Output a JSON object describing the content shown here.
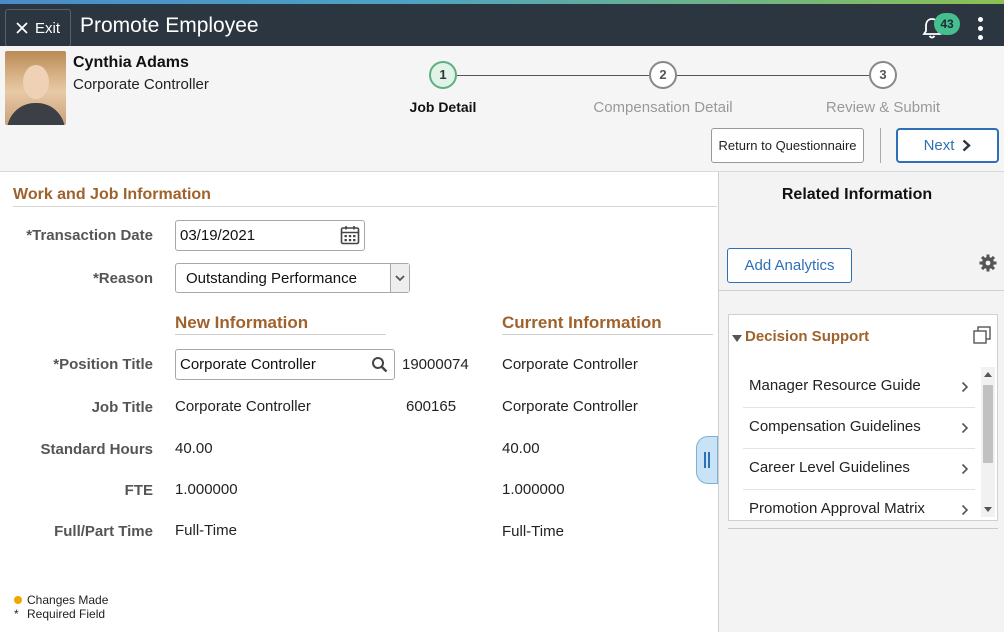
{
  "header": {
    "exit_label": "Exit",
    "app_title": "Promote Employee",
    "notification_count": "43"
  },
  "employee": {
    "name": "Cynthia Adams",
    "title": "Corporate Controller"
  },
  "steps": [
    {
      "number": "1",
      "label": "Job Detail",
      "active": true
    },
    {
      "number": "2",
      "label": "Compensation Detail",
      "active": false
    },
    {
      "number": "3",
      "label": "Review & Submit",
      "active": false
    }
  ],
  "actions": {
    "return_label": "Return to Questionnaire",
    "next_label": "Next"
  },
  "main": {
    "section_title": "Work and Job Information",
    "transaction_date_label": "*Transaction Date",
    "transaction_date_value": "03/19/2021",
    "reason_label": "*Reason",
    "reason_value": "Outstanding Performance",
    "new_info_header": "New Information",
    "current_info_header": "Current Information",
    "rows": {
      "position_title": {
        "label": "*Position Title",
        "new": "Corporate Controller",
        "code": "19000074",
        "current": "Corporate Controller"
      },
      "job_title": {
        "label": "Job Title",
        "new": "Corporate Controller",
        "code": "600165",
        "current": "Corporate Controller"
      },
      "standard_hours": {
        "label": "Standard Hours",
        "new": "40.00",
        "current": "40.00"
      },
      "fte": {
        "label": "FTE",
        "new": "1.000000",
        "current": "1.000000"
      },
      "full_part_time": {
        "label": "Full/Part Time",
        "new": "Full-Time",
        "current": "Full-Time"
      }
    },
    "legend": {
      "changes_made": "Changes Made",
      "required_marker": "*",
      "required_field": "Required Field"
    }
  },
  "sidebar": {
    "title": "Related Information",
    "add_analytics_label": "Add Analytics",
    "decision_support": {
      "title": "Decision Support",
      "items": [
        "Manager Resource Guide",
        "Compensation Guidelines",
        "Career Level Guidelines",
        "Promotion Approval Matrix"
      ]
    }
  },
  "colors": {
    "topbar": "#2b3640",
    "accent": "#2f6fb6",
    "section_heading": "#a0622d",
    "badge": "#46bf8f",
    "changes_dot": "#f0a800"
  }
}
